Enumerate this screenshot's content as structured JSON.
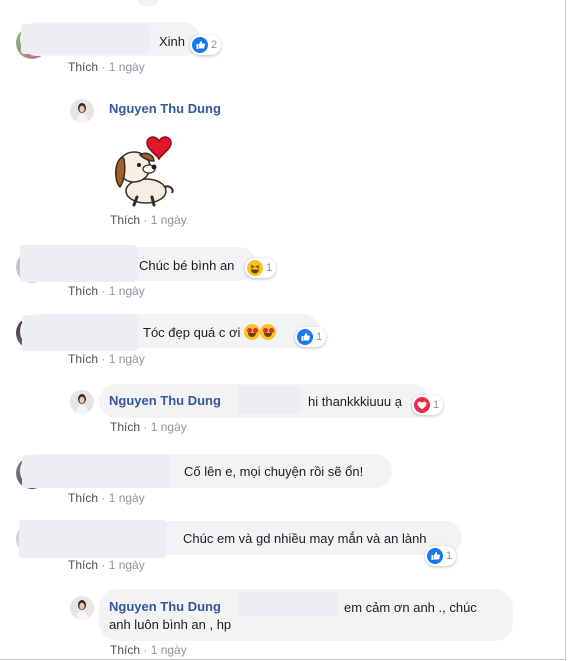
{
  "ui": {
    "like_label": "Thích",
    "separator": "·"
  },
  "comments": [
    {
      "text": "Xinh",
      "time": "1 ngày",
      "reaction_count": "2"
    },
    {
      "author": "Nguyen Thu Dung",
      "sticker": "dog-heart-sticker",
      "time": "1 ngày"
    },
    {
      "text": "Chúc bé bình an",
      "time": "1 ngày",
      "reaction_count": "1"
    },
    {
      "text": "Tóc đẹp quá c ơi",
      "time": "1 ngày",
      "reaction_count": "1"
    },
    {
      "author": "Nguyen Thu Dung",
      "text": "hi thankkkiuuu ạ",
      "time": "1 ngày",
      "reaction_count": "1"
    },
    {
      "text": "Cố lên e, mọi chuyện rồi sẽ ổn!",
      "time": "1 ngày"
    },
    {
      "text": "Chúc em và gd nhiều may mắn và an lành",
      "time": "1 ngày",
      "reaction_count": "1"
    },
    {
      "author": "Nguyen Thu Dung",
      "text_line1": "em cảm ơn anh ., chúc",
      "text_line2": "anh luôn bình an , hp",
      "time": "1 ngày"
    }
  ],
  "colors": {
    "author": "#365899",
    "meta": "#90949c",
    "bubble": "#f2f3f5",
    "like_blue": "#1877f2",
    "love_red": "#f0284a"
  }
}
